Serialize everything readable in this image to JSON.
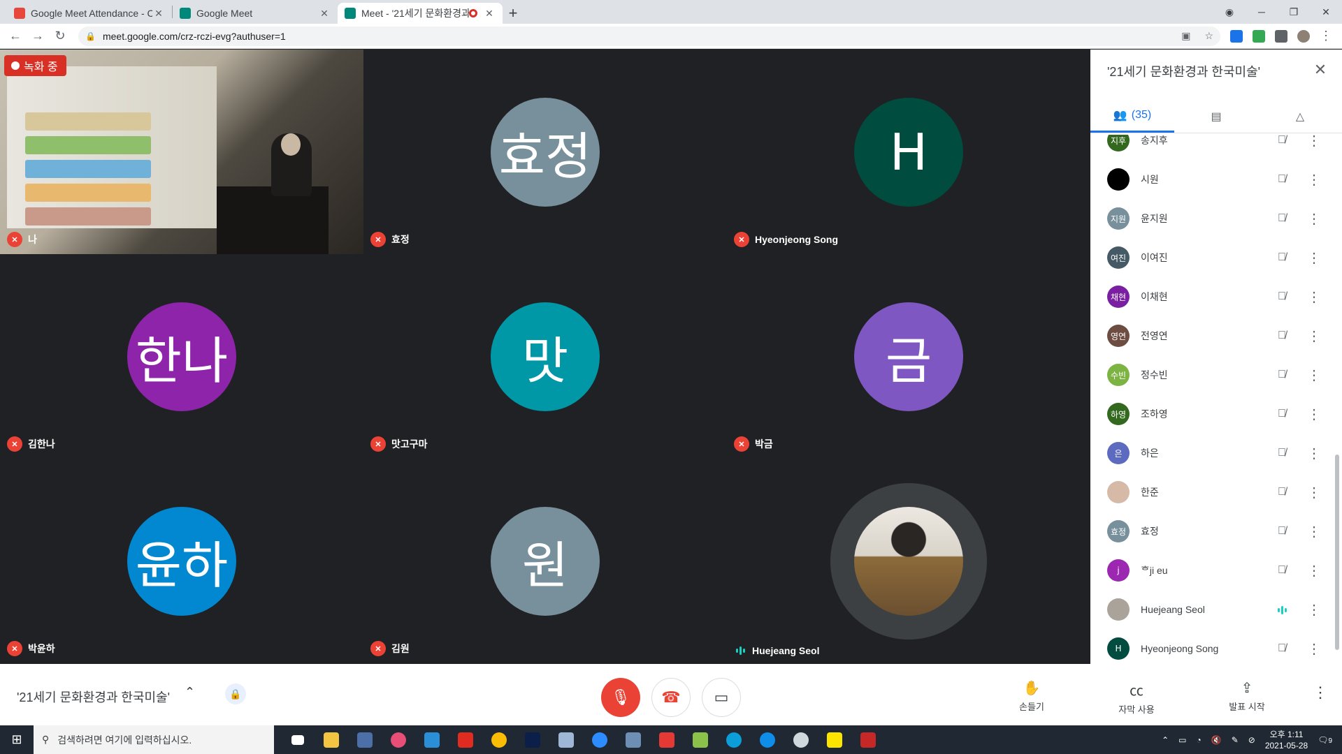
{
  "browser": {
    "tabs": [
      {
        "title": "Google Meet Attendance - Chro",
        "favicon_color": "#e8453c"
      },
      {
        "title": "Google Meet",
        "favicon_color": "#00897b"
      },
      {
        "title": "Meet - '21세기 문화환경과",
        "favicon_color": "#00897b"
      }
    ],
    "new_tab": "+",
    "url": "meet.google.com/crz-rczi-evg?authuser=1"
  },
  "meeting": {
    "recording_label": "녹화 중",
    "name": "'21세기 문화환경과 한국미술'"
  },
  "tiles": [
    {
      "name": "나",
      "type": "video",
      "mic": "muted"
    },
    {
      "name": "효정",
      "initials": "효정",
      "color": "#78909c",
      "mic": "muted"
    },
    {
      "name": "Hyeonjeong Song",
      "initials": "H",
      "color": "#004d40",
      "mic": "muted"
    },
    {
      "name": "김한나",
      "initials": "한나",
      "color": "#8e24aa",
      "mic": "muted"
    },
    {
      "name": "맛고구마",
      "initials": "맛",
      "color": "#0097a7",
      "mic": "muted"
    },
    {
      "name": "박금",
      "initials": "금",
      "color": "#7e57c2",
      "mic": "muted"
    },
    {
      "name": "박윤하",
      "initials": "윤하",
      "color": "#0288d1",
      "mic": "muted"
    },
    {
      "name": "김원",
      "initials": "원",
      "color": "#78909c",
      "mic": "muted"
    },
    {
      "name": "Huejeang Seol",
      "type": "photo",
      "mic": "speaking"
    }
  ],
  "panel": {
    "title": "'21세기 문화환경과 한국미술'",
    "people_count": "(35)",
    "participants": [
      {
        "name": "송지후",
        "initials": "지후",
        "color": "#33691e"
      },
      {
        "name": "시원",
        "initials": "",
        "color": "#000000"
      },
      {
        "name": "윤지원",
        "initials": "지원",
        "color": "#78909c"
      },
      {
        "name": "이여진",
        "initials": "여진",
        "color": "#455a64"
      },
      {
        "name": "이채현",
        "initials": "채현",
        "color": "#7b1fa2"
      },
      {
        "name": "전영연",
        "initials": "영연",
        "color": "#6d4c41"
      },
      {
        "name": "정수빈",
        "initials": "수빈",
        "color": "#7cb342"
      },
      {
        "name": "조하영",
        "initials": "하영",
        "color": "#33691e"
      },
      {
        "name": "하은",
        "initials": "은",
        "color": "#5c6bc0"
      },
      {
        "name": "한준",
        "initials": "",
        "color": "#d7b9a8"
      },
      {
        "name": "효정",
        "initials": "효정",
        "color": "#78909c"
      },
      {
        "name": "ᄒji eu",
        "initials": "j",
        "color": "#9c27b0"
      },
      {
        "name": "Huejeang Seol",
        "initials": "",
        "color": "#a9a39a",
        "speaking": true
      },
      {
        "name": "Hyeonjeong Song",
        "initials": "H",
        "color": "#004d40"
      }
    ]
  },
  "bottom": {
    "raise_hand": "손들기",
    "captions": "자막 사용",
    "present": "발표 시작"
  },
  "taskbar": {
    "search_placeholder": "검색하려면 여기에 입력하십시오.",
    "time": "오후 1:11",
    "date": "2021-05-28",
    "notifications": "9"
  }
}
